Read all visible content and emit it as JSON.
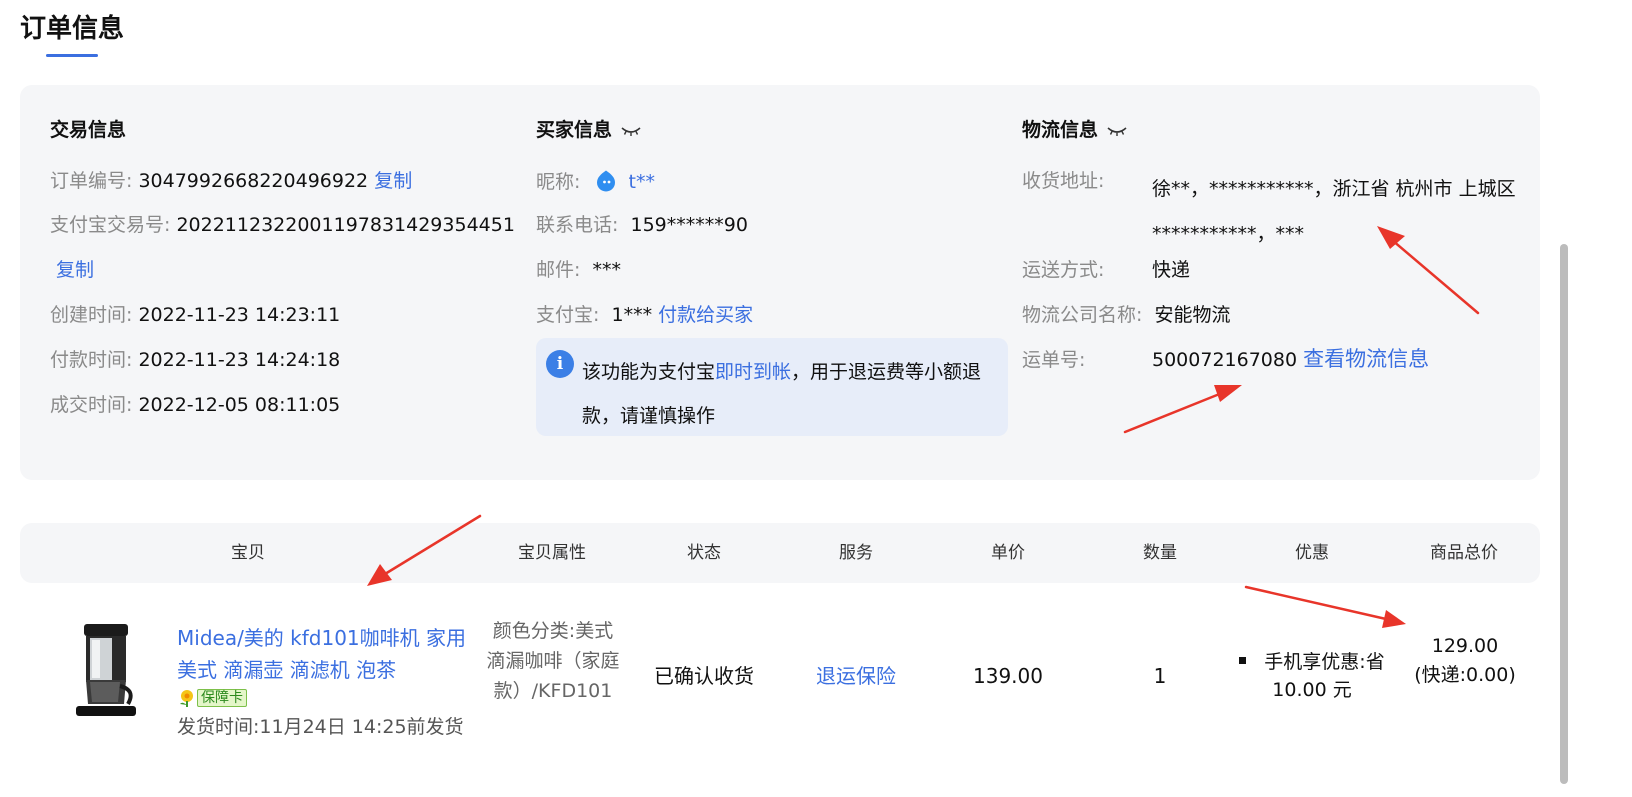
{
  "page": {
    "title": "订单信息"
  },
  "trade": {
    "title": "交易信息",
    "order_no_label": "订单编号:",
    "order_no": "3047992668220496922",
    "copy_label": "复制",
    "alipay_trade_label": "支付宝交易号:",
    "alipay_trade_no": "2022112322001197831429354451",
    "copy2_label": "复制",
    "created_label": "创建时间:",
    "created": "2022-11-23 14:23:11",
    "paid_label": "付款时间:",
    "paid": "2022-11-23 14:24:18",
    "deal_label": "成交时间:",
    "deal": "2022-12-05 08:11:05"
  },
  "buyer": {
    "title": "买家信息",
    "nickname_label": "昵称:",
    "nickname": "t**",
    "phone_label": "联系电话:",
    "phone": "159******90",
    "email_label": "邮件:",
    "email": "***",
    "alipay_label": "支付宝:",
    "alipay": "1***",
    "pay_buyer_link": "付款给买家",
    "notice_prefix": "该功能为支付宝",
    "notice_highlight": "即时到帐",
    "notice_suffix": "，用于退运费等小额退款，请谨慎操作"
  },
  "logistics": {
    "title": "物流信息",
    "address_label": "收货地址:",
    "address": "徐**，***********，浙江省 杭州市 上城区 ***********，***",
    "method_label": "运送方式:",
    "method": "快递",
    "company_label": "物流公司名称:",
    "company": "安能物流",
    "waybill_label": "运单号:",
    "waybill": "500072167080",
    "view_link": "查看物流信息"
  },
  "table": {
    "headers": [
      "宝贝",
      "宝贝属性",
      "状态",
      "服务",
      "单价",
      "数量",
      "优惠",
      "商品总价"
    ]
  },
  "product": {
    "name": "Midea/美的 kfd101咖啡机 家用美式 滴漏壶 滴滤机 泡茶",
    "guarantee": "保障卡",
    "ship_time": "发货时间:11月24日 14:25前发货",
    "attributes": "颜色分类:美式滴漏咖啡（家庭款）/KFD101",
    "status": "已确认收货",
    "service": "退运保险",
    "unit_price": "139.00",
    "quantity": "1",
    "promo": "手机享优惠:省 10.00 元",
    "total": "129.00",
    "total_shipping": "(快递:0.00)"
  },
  "colors": {
    "accent": "#3b6fe0",
    "panel_bg": "#f5f6f8",
    "arrow": "#e8352a"
  }
}
